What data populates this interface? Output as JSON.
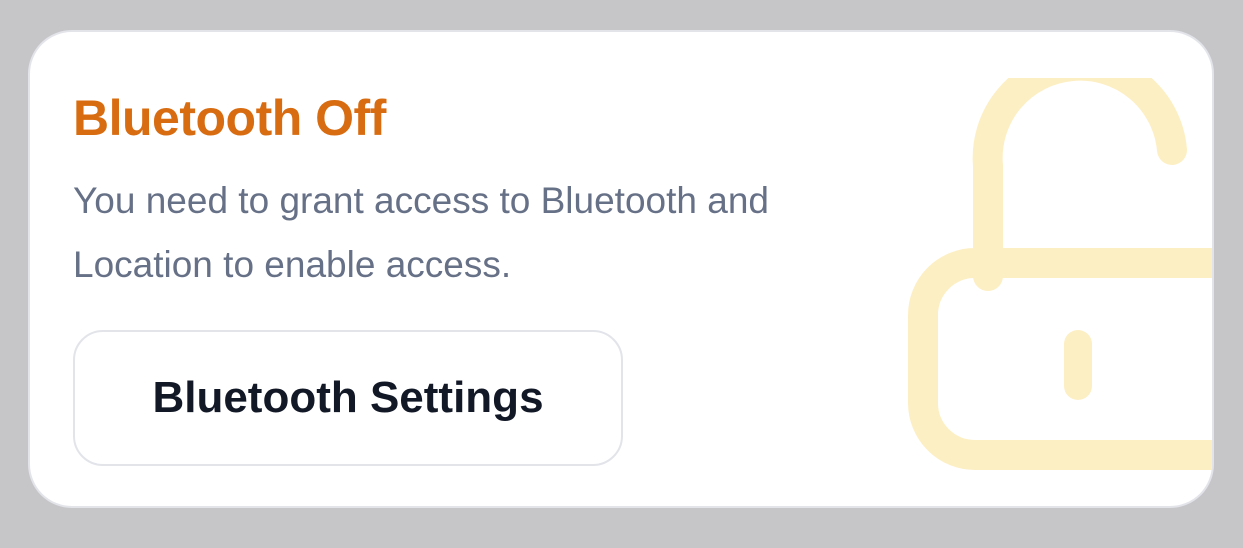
{
  "card": {
    "title": "Bluetooth Off",
    "description": "You need to grant access to Bluetooth and Location to enable access.",
    "button_label": "Bluetooth Settings",
    "background_icon": "unlocked-padlock-icon"
  },
  "colors": {
    "page_background": "#c6c6c9",
    "card_background": "#ffffff",
    "title": "#d86c11",
    "description": "#667086",
    "button_text": "#121826",
    "button_border": "#e2e4ea",
    "lock_icon": "#fdefc4"
  }
}
